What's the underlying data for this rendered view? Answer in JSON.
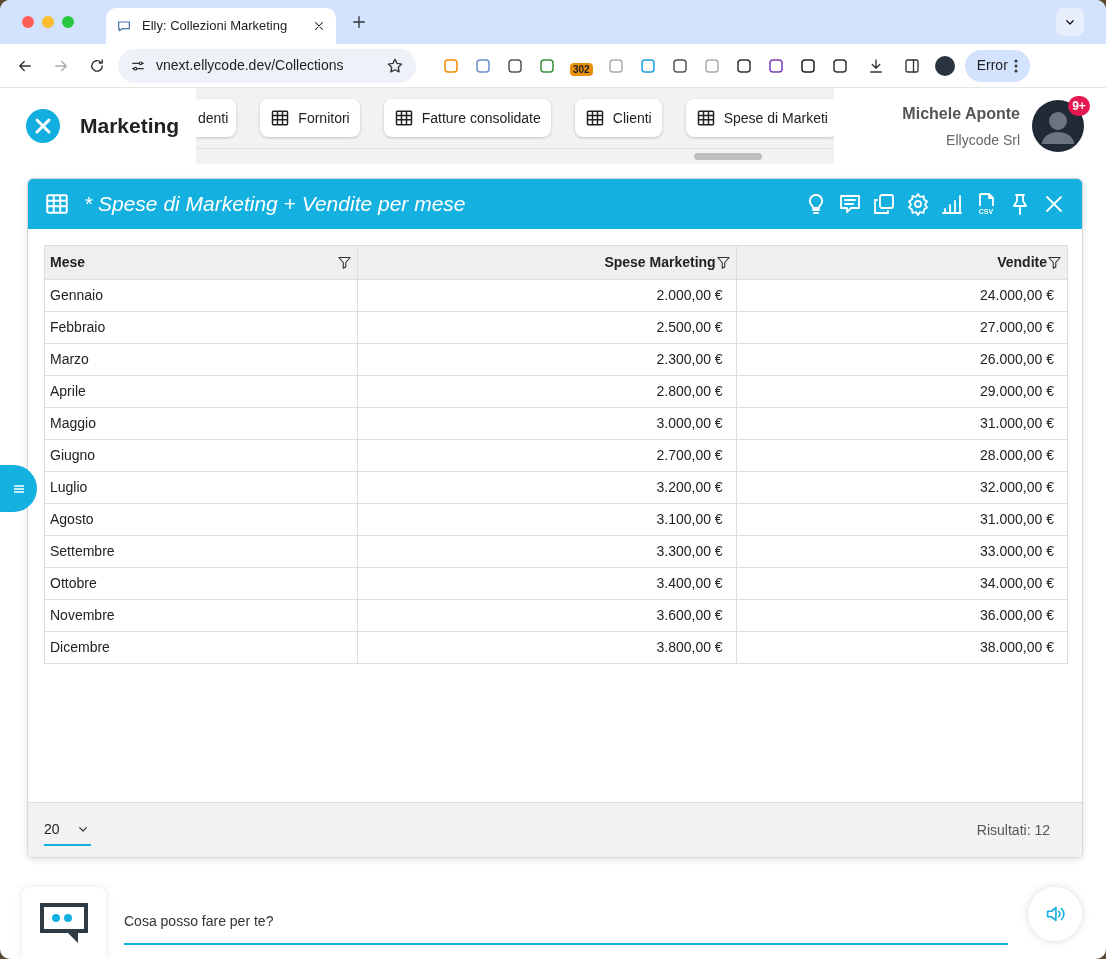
{
  "browser": {
    "tab_title": "Elly: Collezioni Marketing",
    "url": "vnext.ellycode.dev/Collections",
    "extension_badge": "302",
    "error_button": "Error"
  },
  "header": {
    "title": "Marketing",
    "nav_tabs": [
      {
        "label": "denti",
        "kind": "cut"
      },
      {
        "label": "Fornitori",
        "kind": "table"
      },
      {
        "label": "Fatture consolidate",
        "kind": "table"
      },
      {
        "label": "Clienti",
        "kind": "table"
      },
      {
        "label": "Spese di Marketi",
        "kind": "table"
      }
    ]
  },
  "user": {
    "name": "Michele Aponte",
    "company": "Ellycode Srl",
    "badge": "9+"
  },
  "panel": {
    "title": "* Spese di Marketing + Vendite per mese",
    "columns": [
      "Mese",
      "Spese Marketing",
      "Vendite"
    ],
    "rows": [
      [
        "Gennaio",
        "2.000,00 €",
        "24.000,00 €"
      ],
      [
        "Febbraio",
        "2.500,00 €",
        "27.000,00 €"
      ],
      [
        "Marzo",
        "2.300,00 €",
        "26.000,00 €"
      ],
      [
        "Aprile",
        "2.800,00 €",
        "29.000,00 €"
      ],
      [
        "Maggio",
        "3.000,00 €",
        "31.000,00 €"
      ],
      [
        "Giugno",
        "2.700,00 €",
        "28.000,00 €"
      ],
      [
        "Luglio",
        "3.200,00 €",
        "32.000,00 €"
      ],
      [
        "Agosto",
        "3.100,00 €",
        "31.000,00 €"
      ],
      [
        "Settembre",
        "3.300,00 €",
        "33.000,00 €"
      ],
      [
        "Ottobre",
        "3.400,00 €",
        "34.000,00 €"
      ],
      [
        "Novembre",
        "3.600,00 €",
        "36.000,00 €"
      ],
      [
        "Dicembre",
        "3.800,00 €",
        "38.000,00 €"
      ]
    ],
    "csv_label": "CSV",
    "page_size": "20",
    "results": "Risultati: 12"
  },
  "chat": {
    "placeholder": "Cosa posso fare per te?"
  }
}
